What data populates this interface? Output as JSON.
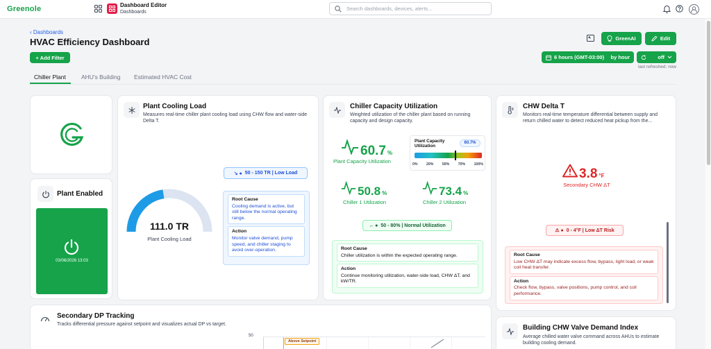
{
  "app": {
    "logo": "Greenole",
    "title": "Dashboard Editor",
    "subtitle": "Dashboards",
    "search_placeholder": "Search dashboards, devices, alerts..."
  },
  "header": {
    "breadcrumb": "Dashboards",
    "title": "HVAC Efficiency Dashboard",
    "add_filter": "+ Add Filter",
    "greenai": "GreenAI",
    "edit": "Edit",
    "time_range": "6 hours (GMT-03:00)",
    "group_by": "by hour",
    "refresh": "off",
    "last_refreshed": "last refreshed: now"
  },
  "tabs": [
    {
      "label": "Chiller Plant"
    },
    {
      "label": "AHU's Building"
    },
    {
      "label": "Estimated HVAC Cost"
    }
  ],
  "plant": {
    "title": "Plant Enabled",
    "timestamp": "03/06/2026 13:03"
  },
  "cooling_load": {
    "title": "Plant Cooling Load",
    "desc": "Measures real-time chiller plant cooling load using CHW flow and water-side Delta T.",
    "value": "111.0 TR",
    "label": "Plant Cooling Load",
    "gauge_fraction": 0.45,
    "range_badge": "50 - 150 TR | Low Load",
    "root_cause_title": "Root Cause",
    "root_cause": "Cooling demand is active, but still below the normal operating range.",
    "action_title": "Action",
    "action": "Monitor valve demand, pump speed, and chiller staging to avoid over-operation."
  },
  "capacity": {
    "title": "Chiller Capacity Utilization",
    "desc": "Weighted utilization of the chiller plant based on running capacity and design capacity.",
    "plant_value": "60.7",
    "plant_label": "Plant Capacity Utilization",
    "unit": "%",
    "bar_title": "Plant Capacity Utilization",
    "bar_value": "60.7%",
    "bar_fraction": 0.607,
    "ticks": [
      "0%",
      "20%",
      "50%",
      "70%",
      "100%"
    ],
    "c1_value": "50.8",
    "c1_label": "Chiller 1 Utilization",
    "c2_value": "73.4",
    "c2_label": "Chiller 2 Utilization",
    "range_badge": "50 - 80% | Normal Utilization",
    "root_cause_title": "Root Cause",
    "root_cause": "Chiller utilization is within the expected operating range.",
    "action_title": "Action",
    "action": "Continue monitoring utilization, water-side load, CHW ΔT, and kW/TR."
  },
  "delta_t": {
    "title": "CHW Delta T",
    "desc": "Monitors real-time temperature differential between supply and return chilled water to detect reduced heat pickup from the...",
    "value": "3.8",
    "unit": "°F",
    "label": "Secondary CHW ΔT",
    "range_badge": "0 - 4°F | Low ΔT Risk",
    "root_cause_title": "Root Cause",
    "root_cause": "Low CHW ΔT may indicate excess flow, bypass, light load, or weak coil heat transfer.",
    "action_title": "Action",
    "action": "Check flow, bypass, valve positions, pump control, and coil performance."
  },
  "dp": {
    "title": "Secondary DP Tracking",
    "desc": "Tracks differential pressure against setpoint and visualizes actual DP vs target.",
    "y_tick": "50",
    "annotation": "Above Setpoint"
  },
  "valve": {
    "title": "Building CHW Valve Demand Index",
    "desc": "Average chilled water valve command across AHUs to estimate building cooling demand."
  },
  "colors": {
    "green": "#16a34a",
    "red": "#dc2626",
    "blue": "#1d4ed8",
    "gauge_blue": "#1e9be6"
  }
}
